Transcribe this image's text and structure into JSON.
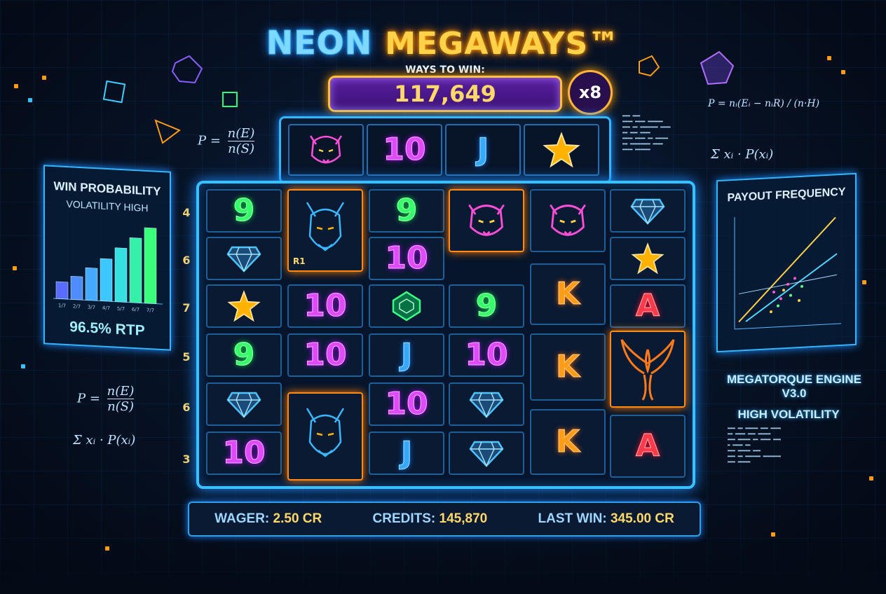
{
  "title": {
    "neon": "NEON",
    "mega": "MEGAWAYS™"
  },
  "ways": {
    "label": "WAYS TO WIN:",
    "value": "117,649"
  },
  "multiplier": "x8",
  "top_reel": [
    "tiger",
    "10",
    "J",
    "star"
  ],
  "row_labels": [
    "4",
    "6",
    "7",
    "5",
    "6",
    "3"
  ],
  "board": [
    [
      "9",
      "diamond",
      "star",
      "9",
      "diamond",
      "10"
    ],
    [
      "dragon",
      "",
      "10",
      "10",
      "dragon",
      ""
    ],
    [
      "9",
      "10",
      "emerald",
      "J",
      "10",
      "J"
    ],
    [
      "tiger",
      "",
      "9",
      "10",
      "diamond",
      "diamond"
    ],
    [
      "tiger",
      "",
      "K",
      "K",
      "",
      "K"
    ],
    [
      "diamond",
      "star",
      "A",
      "phoenix",
      "",
      "A"
    ]
  ],
  "dragon_tag": "R1",
  "left_panel": {
    "title": "WIN PROBABILITY",
    "subtitle": "VOLATILITY HIGH",
    "rtp": "96.5% RTP",
    "bars": [
      0.22,
      0.3,
      0.42,
      0.55,
      0.7,
      0.84,
      0.98
    ],
    "bar_labels": [
      "1/7",
      "2/7",
      "3/7",
      "4/7",
      "5/7",
      "6/7",
      "7/7"
    ]
  },
  "right_panel": {
    "title": "PAYOUT FREQUENCY"
  },
  "engine": "MEGATORQUE ENGINE V3.0",
  "volatility": "HIGH VOLATILITY",
  "formulas": {
    "prob_num": "n(E)",
    "prob_den": "n(S)",
    "prob_lhs": "P =",
    "sum": "Σ xᵢ · P(xᵢ)",
    "right": "P = nᵢ(Eᵢ − nᵢR) / (n·H)"
  },
  "status_bar": {
    "wager_label": "WAGER:",
    "wager_value": "2.50 CR",
    "credits_label": "CREDITS:",
    "credits_value": "145,870",
    "lastwin_label": "LAST WIN:",
    "lastwin_value": "345.00 CR"
  },
  "colors": {
    "accent": "#39c0ff",
    "gold": "#ffd86b",
    "purple": "#5b1fa0"
  }
}
